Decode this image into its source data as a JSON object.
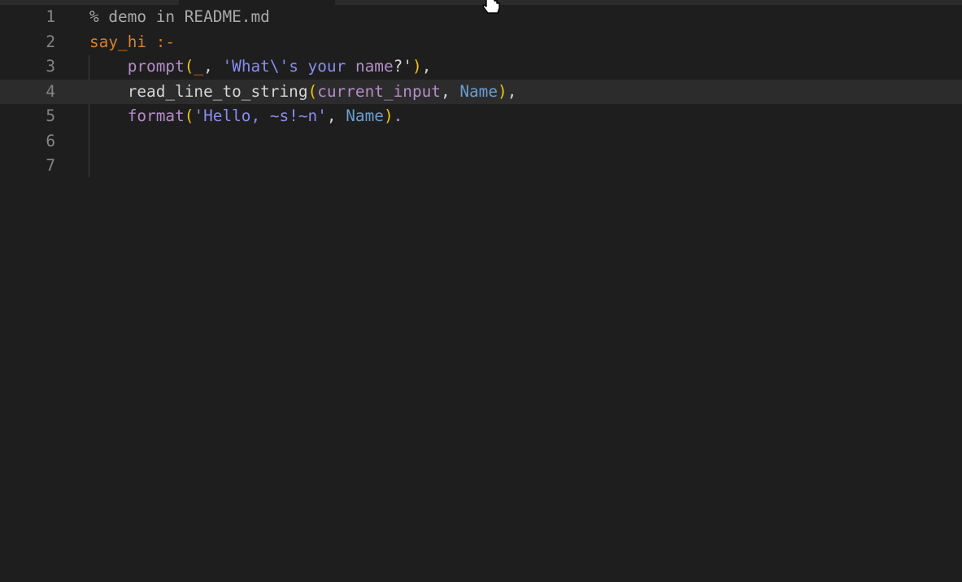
{
  "editor": {
    "lines": [
      {
        "number": "1",
        "tokens": [
          {
            "t": "% demo in README.md",
            "k": "comment"
          }
        ]
      },
      {
        "number": "2",
        "tokens": [
          {
            "t": "say_hi",
            "k": "head"
          },
          {
            "t": " ",
            "k": "plain"
          },
          {
            "t": ":-",
            "k": "neck"
          }
        ]
      },
      {
        "number": "3",
        "tokens": [
          {
            "t": "    prompt",
            "k": "builtin"
          },
          {
            "t": "(",
            "k": "paren"
          },
          {
            "t": "_",
            "k": "anon"
          },
          {
            "t": ", ",
            "k": "plain"
          },
          {
            "t": "'What\\'s your ",
            "k": "str"
          },
          {
            "t": "name",
            "k": "builtin"
          },
          {
            "t": "?'",
            "k": "plain"
          },
          {
            "t": ")",
            "k": "paren"
          },
          {
            "t": ",",
            "k": "plain"
          }
        ]
      },
      {
        "number": "4",
        "tokens": [
          {
            "t": "    read_line_to_string",
            "k": "plain"
          },
          {
            "t": "(",
            "k": "paren"
          },
          {
            "t": "current_input",
            "k": "builtin"
          },
          {
            "t": ", ",
            "k": "plain"
          },
          {
            "t": "Name",
            "k": "var"
          },
          {
            "t": ")",
            "k": "paren"
          },
          {
            "t": ",",
            "k": "plain"
          }
        ]
      },
      {
        "number": "5",
        "tokens": [
          {
            "t": "    format",
            "k": "builtin"
          },
          {
            "t": "(",
            "k": "paren"
          },
          {
            "t": "'Hello, ~s!~n'",
            "k": "str"
          },
          {
            "t": ", ",
            "k": "plain"
          },
          {
            "t": "Name",
            "k": "var"
          },
          {
            "t": ")",
            "k": "paren"
          },
          {
            "t": ".",
            "k": "dot"
          }
        ]
      },
      {
        "number": "6",
        "tokens": []
      },
      {
        "number": "7",
        "tokens": []
      }
    ],
    "current_line": 4
  },
  "colors": {
    "background": "#1e1e1e",
    "line_highlight": "#2c2c2c",
    "line_number": "#858585",
    "comment": "#a9a9a9",
    "head": "#d9802d",
    "builtin": "#b58cc8",
    "paren": "#f1c40f",
    "string": "#8a8cf0",
    "variable": "#6b9cd0"
  },
  "icons": {
    "mouse_cursor": "hand-pointer-icon"
  }
}
